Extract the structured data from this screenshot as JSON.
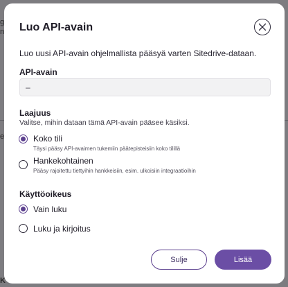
{
  "background": {
    "left_fragments": [
      "g",
      "nt",
      "e"
    ],
    "bottom_fragment": "K"
  },
  "dialog": {
    "title": "Luo API-avain",
    "close_icon": "close-icon",
    "intro": "Luo uusi API-avain ohjelmallista pääsyä varten Sitedrive-dataan.",
    "api_key": {
      "label": "API-avain",
      "value": "–"
    },
    "scope": {
      "label": "Laajuus",
      "help": "Valitse, mihin dataan tämä API-avain pääsee käsiksi.",
      "options": [
        {
          "label": "Koko tili",
          "description": "Täysi pääsy API-avaimen tukemiin päätepisteisiin koko tilillä",
          "checked": true
        },
        {
          "label": "Hankekohtainen",
          "description": "Pääsy rajoitettu tiettyihin hankkeisiin, esim. ulkoisiin integraatioihin",
          "checked": false
        }
      ]
    },
    "permission": {
      "label": "Käyttöoikeus",
      "options": [
        {
          "label": "Vain luku",
          "checked": true
        },
        {
          "label": "Luku ja kirjoitus",
          "checked": false
        }
      ]
    },
    "buttons": {
      "close": "Sulje",
      "add": "Lisää"
    },
    "colors": {
      "accent": "#6b4ea5",
      "radio_checked": "#5b3f8e",
      "backdrop": "#7d7c80"
    }
  }
}
